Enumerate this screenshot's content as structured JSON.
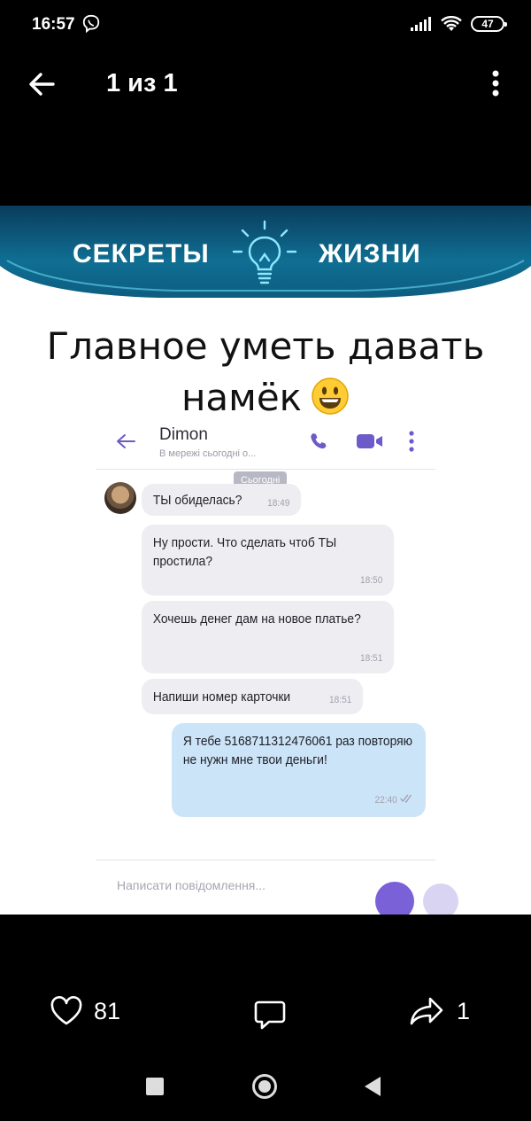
{
  "status_bar": {
    "time": "16:57",
    "battery": "47"
  },
  "app_bar": {
    "title": "1 из 1"
  },
  "image": {
    "banner": {
      "left": "СЕКРЕТЫ",
      "right": "ЖИЗНИ"
    },
    "caption": {
      "line1": "Главное уметь давать",
      "line2": "намёк"
    },
    "chat": {
      "contact": "Dimon",
      "status": "В мережі сьогодні о...",
      "date_label": "Сьогодні",
      "messages": [
        {
          "text": "ТЫ обиделась?",
          "time": "18:49"
        },
        {
          "text": "Ну прости. Что сделать чтоб ТЫ простила?",
          "time": "18:50"
        },
        {
          "text": "Хочешь денег дам на новое платье?",
          "time": "18:51"
        },
        {
          "text": "Напиши номер карточки",
          "time": "18:51"
        },
        {
          "text": "Я тебе 5168711312476061 раз повторяю не нужн мне твои деньги!",
          "time": "22:40"
        }
      ],
      "input_placeholder": "Написати повідомлення..."
    }
  },
  "actions": {
    "likes": "81",
    "shares": "1"
  },
  "colors": {
    "banner": "#0f6f93",
    "outgoing_bubble": "#cce4f7",
    "incoming_bubble": "#eeeef2",
    "viber_purple": "#7b61d8"
  }
}
